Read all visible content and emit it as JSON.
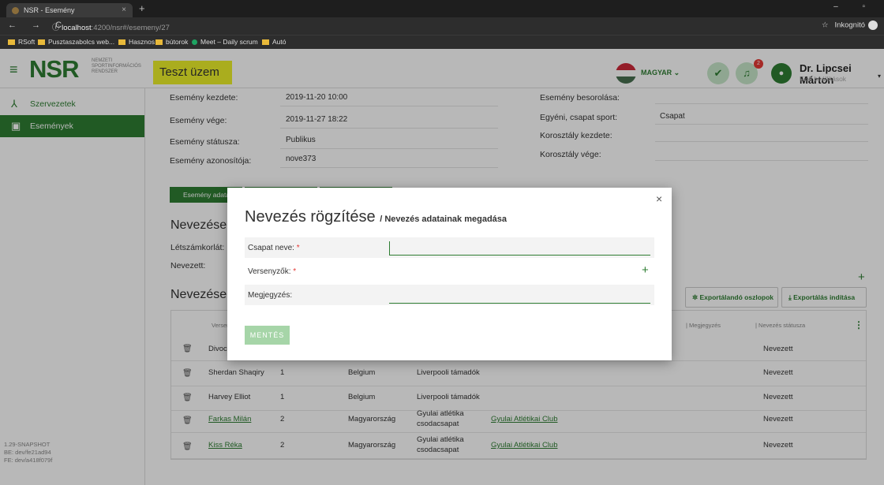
{
  "browser": {
    "tab_title": "NSR - Esemény",
    "tab_close": "×",
    "new_tab": "+",
    "window_controls": "– ▫",
    "nav": "← → C",
    "url_host": "localhost",
    "url_path": ":4200/nsr#/esemeny/27",
    "incognito": "Inkognitó",
    "bookmarks": [
      "RSoft",
      "Pusztaszabolcs web...",
      "Hasznos",
      "bútorok",
      "Meet – Daily scrum",
      "Autó"
    ]
  },
  "header": {
    "logo": "NSR",
    "logo_sub": "NEMZETI SPORTINFORMÁCIÓS RENDSZER",
    "test_banner": "Teszt üzem alatt!",
    "language": "MAGYAR ⌄",
    "notif_count": "2",
    "user_name": "Dr. Lipcsei Márton",
    "user_sub": "Fiók beállítások"
  },
  "sidebar": {
    "items": [
      {
        "label": "Szervezetek",
        "icon": "org-tree-icon"
      },
      {
        "label": "Események",
        "icon": "calendar-icon"
      }
    ],
    "version": [
      "1.29-SNAPSHOT",
      "BE: dev/fe21ad94",
      "FE: dev/a418f079f"
    ]
  },
  "event": {
    "left": [
      {
        "label": "Esemény kezdete:",
        "value": "2019-11-20 10:00"
      },
      {
        "label": "Esemény vége:",
        "value": "2019-11-27 18:22"
      },
      {
        "label": "Esemény státusza:",
        "value": "Publikus"
      },
      {
        "label": "Esemény azonosítója:",
        "value": "nove373"
      }
    ],
    "right": [
      {
        "label": "Esemény besorolása:",
        "value": ""
      },
      {
        "label": "Egyéni, csapat sport:",
        "value": "Csapat"
      },
      {
        "label": "Korosztály kezdete:",
        "value": ""
      },
      {
        "label": "Korosztály vége:",
        "value": ""
      }
    ]
  },
  "tabs": {
    "active": "Esemény adatai"
  },
  "section": {
    "entries_title": "Nevezések",
    "headcount_label": "Létszámkorlát:",
    "entered_label": "Nevezett:",
    "list_title": "Nevezések",
    "export_columns": "Exportálandó oszlopok",
    "export_start": "Exportálás indítása"
  },
  "table": {
    "headers": [
      "Versenyző",
      "| Megjegyzés",
      "| Nevezés státusza"
    ],
    "rows": [
      {
        "name": "Divock Origi",
        "num": "",
        "country": "",
        "team": "",
        "club": "",
        "status": "Nevezett"
      },
      {
        "name": "Sherdan Shaqiry",
        "num": "1",
        "country": "Belgium",
        "team": "Liverpooli támadók",
        "club": "",
        "status": "Nevezett"
      },
      {
        "name": "Harvey Elliot",
        "num": "1",
        "country": "Belgium",
        "team": "Liverpooli támadók",
        "club": "",
        "status": "Nevezett"
      },
      {
        "name": "Farkas Milán",
        "num": "2",
        "country": "Magyarország",
        "team": "Gyulai atlétika csodacsapat",
        "club": "Gyulai Atlétikai Club",
        "status": "Nevezett"
      },
      {
        "name": "Kiss Réka",
        "num": "2",
        "country": "Magyarország",
        "team": "Gyulai atlétika csodacsapat",
        "club": "Gyulai Atlétikai Club",
        "status": "Nevezett"
      }
    ]
  },
  "modal": {
    "title": "Nevezés rögzítése",
    "subtitle": "/ Nevezés adatainak megadása",
    "team_name_label": "Csapat neve:",
    "competitors_label": "Versenyzők:",
    "comment_label": "Megjegyzés:",
    "required_mark": "*",
    "team_name_value": "",
    "comment_value": "",
    "save": "MENTÉS",
    "close": "×"
  },
  "colors": {
    "brand_green": "#2e7d32",
    "test_yellow": "#ecf02a",
    "badge_red": "#e53935"
  }
}
